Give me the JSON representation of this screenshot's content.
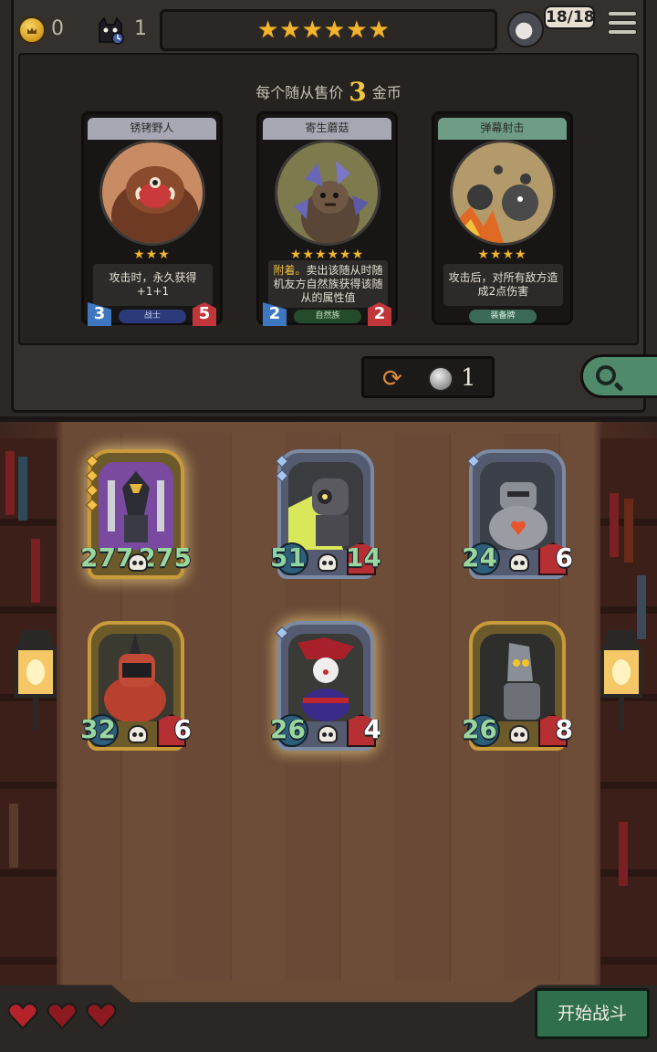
{
  "hud": {
    "gold": "0",
    "turn": "1",
    "tavern_stars": "★★★★★★",
    "health": "18/18",
    "icons": [
      "gold-coin-icon",
      "black-cat-clock-icon",
      "hero-avatar-icon",
      "menu-icon"
    ]
  },
  "shop": {
    "sell_price_prefix": "每个随从售价",
    "sell_price_value": "3",
    "sell_price_suffix": "金币",
    "cards": [
      {
        "name": "锈铐野人",
        "stars": "★★★",
        "description": "攻击时，永久获得+1+1",
        "tribe": "战士",
        "attack": "3",
        "health": "5",
        "frame": "silver"
      },
      {
        "name": "寄生蘑菇",
        "stars": "★★★★★★",
        "description_highlight": "附着。",
        "description": "卖出该随从时随机友方自然族获得该随从的属性值",
        "tribe": "自然族",
        "attack": "2",
        "health": "2",
        "frame": "silver"
      },
      {
        "name": "弹幕射击",
        "stars": "★★★★",
        "description": "攻击后，对所有敌方造成2点伤害",
        "tribe": "装备牌",
        "frame": "green"
      }
    ],
    "refresh_cost": "1"
  },
  "board": {
    "minions": [
      {
        "attack": "277",
        "health": "275",
        "frame": "gold"
      },
      {
        "attack": "51",
        "health": "14",
        "frame": "silver"
      },
      {
        "attack": "24",
        "health": "6",
        "frame": "silver"
      },
      {
        "attack": "32",
        "health": "6",
        "frame": "gold"
      },
      {
        "attack": "26",
        "health": "4",
        "frame": "silver"
      },
      {
        "attack": "26",
        "health": "8",
        "frame": "gold"
      }
    ]
  },
  "footer": {
    "lives": 3,
    "start_button": "开始战斗"
  },
  "colors": {
    "star_gold": "#f2b52c",
    "buff_green": "#9ad6a0",
    "start_button": "#2f6f4b",
    "health_red": "#c0363a",
    "attack_blue": "#3c77c0"
  }
}
